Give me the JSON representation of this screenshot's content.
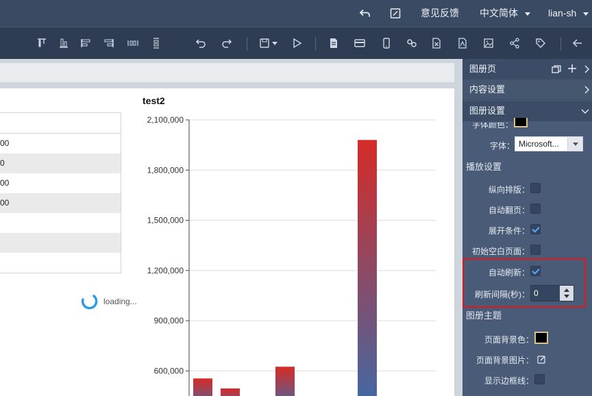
{
  "header": {
    "feedback": "意见反馈",
    "language": "中文简体",
    "user": "lian-sh"
  },
  "toolbar": {
    "icons": [
      "align-top-icon",
      "align-bottom-icon",
      "align-left-icon",
      "align-right-icon",
      "distribute-horizontal-icon",
      "distribute-vertical-icon",
      "undo-icon",
      "redo-icon",
      "save-icon",
      "play-icon",
      "document-icon",
      "card-icon",
      "mobile-icon",
      "link-icon",
      "excel-icon",
      "pdf-icon",
      "image-icon",
      "share-icon",
      "tag-icon",
      "back-icon"
    ]
  },
  "canvas": {
    "table_rows": [
      "",
      "00",
      "0",
      "00",
      "00",
      "",
      "",
      ""
    ],
    "loading_text": "loading..."
  },
  "chart_data": {
    "type": "bar",
    "title": "test2",
    "xlabel": "",
    "ylabel": "",
    "ylim": [
      450000,
      2100000
    ],
    "yticks": [
      "2,100,000",
      "1,800,000",
      "1,500,000",
      "1,200,000",
      "900,000",
      "600,000"
    ],
    "ytick_values": [
      2100000,
      1800000,
      1500000,
      1200000,
      900000,
      600000
    ],
    "values": [
      555000,
      495000,
      0,
      625000,
      0,
      0,
      1980000
    ],
    "colors": {
      "top": "#d62b27",
      "bottom": "#3f6aa6"
    },
    "grid": true
  },
  "panel": {
    "album_page": "图册页",
    "content_settings": "内容设置",
    "album_settings": "图册设置",
    "font_color_label": "字体颜色：",
    "font_label": "字体：",
    "font_value": "Microsoft...",
    "play_settings": "播放设置",
    "vertical_label": "纵向排版：",
    "auto_page_label": "自动翻页：",
    "expand_label": "展开条件：",
    "blank_page_label": "初始空白页面：",
    "auto_refresh_label": "自动刷新：",
    "refresh_interval_label": "刷新间隔(秒)：",
    "refresh_interval_value": "0",
    "album_theme": "图册主题",
    "bg_color_label": "页面背景色：",
    "bg_image_label": "页面背景图片：",
    "border_label": "显示边框线：",
    "vertical": false,
    "auto_page": false,
    "expand": true,
    "blank_page": false,
    "auto_refresh": true,
    "border": false
  }
}
